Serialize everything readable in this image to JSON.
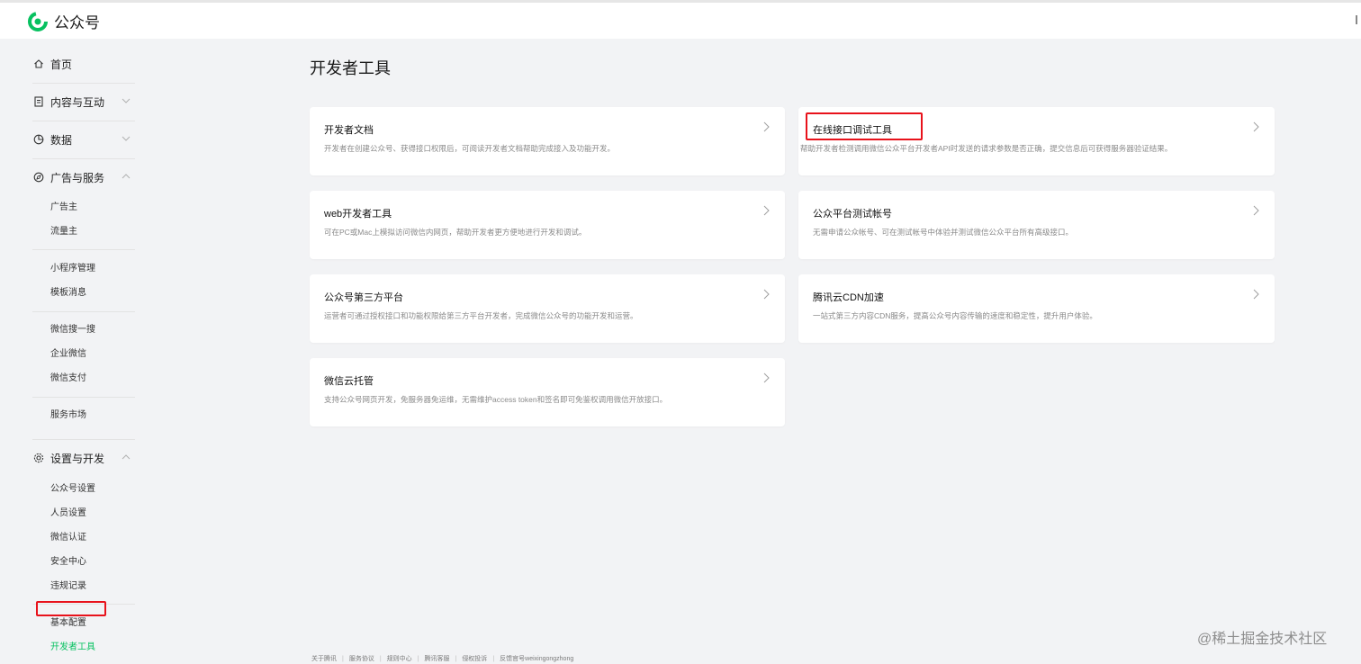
{
  "header": {
    "app_name": "公众号",
    "brand_color": "#07c160"
  },
  "sidebar": {
    "home": "首页",
    "content": "内容与互动",
    "data": "数据",
    "ads": "广告与服务",
    "ads_items": [
      "广告主",
      "流量主"
    ],
    "mini_items": [
      "小程序管理",
      "模板消息"
    ],
    "wx_items": [
      "微信搜一搜",
      "企业微信",
      "微信支付"
    ],
    "market": "服务市场",
    "settings": "设置与开发",
    "settings_items": [
      "公众号设置",
      "人员设置",
      "微信认证",
      "安全中心",
      "违规记录"
    ],
    "dev_items": [
      "基本配置",
      "开发者工具"
    ],
    "active_item": "开发者工具"
  },
  "main": {
    "title": "开发者工具",
    "cards": [
      {
        "title": "开发者文档",
        "desc": "开发者在创建公众号、获得接口权限后，可阅读开发者文档帮助完成接入及功能开发。"
      },
      {
        "title": "在线接口调试工具",
        "desc": "帮助开发者检测调用微信公众平台开发者API时发送的请求参数是否正确，提交信息后可获得服务器验证结果。"
      },
      {
        "title": "web开发者工具",
        "desc": "可在PC或Mac上模拟访问微信内网页，帮助开发者更方便地进行开发和调试。"
      },
      {
        "title": "公众平台测试帐号",
        "desc": "无需申请公众帐号、可在测试帐号中体验并测试微信公众平台所有高级接口。"
      },
      {
        "title": "公众号第三方平台",
        "desc": "运营者可通过授权接口和功能权限给第三方平台开发者，完成微信公众号的功能开发和运营。"
      },
      {
        "title": "腾讯云CDN加速",
        "desc": "一站式第三方内容CDN服务，提高公众号内容传输的速度和稳定性，提升用户体验。"
      },
      {
        "title": "微信云托管",
        "desc": "支持公众号网页开发，免服务器免运维，无需维护access token和签名即可免鉴权调用微信开放接口。"
      }
    ]
  },
  "footer": {
    "links": [
      "关于腾讯",
      "服务协议",
      "规则中心",
      "腾讯客服",
      "侵权投诉",
      "反馈官号weixingongzhong"
    ]
  },
  "watermark": "@稀土掘金技术社区",
  "highlight_color": "#e8121b"
}
